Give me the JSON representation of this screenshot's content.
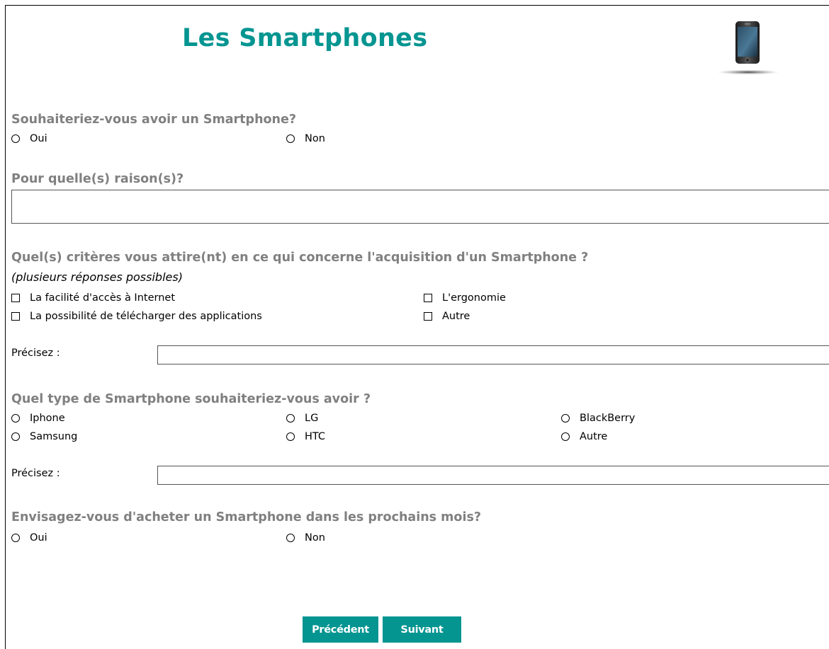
{
  "colors": {
    "accent": "#049591",
    "question": "#808080",
    "text": "#000000"
  },
  "page": {
    "title": "Les Smartphones",
    "logo_icon": "smartphone-icon"
  },
  "q1": {
    "question": "Souhaiteriez-vous avoir un Smartphone?",
    "options": [
      "Oui",
      "Non"
    ]
  },
  "q2": {
    "question": "Pour quelle(s) raison(s)?",
    "value": ""
  },
  "q3": {
    "question": "Quel(s) critères vous attire(nt) en ce qui concerne l'acquisition d'un Smartphone ?",
    "note": "(plusieurs réponses possibles)",
    "options": [
      "La facilité d'accès à Internet",
      "L'ergonomie",
      "La possibilité de télécharger des applications",
      "Autre"
    ],
    "precise_label": "Précisez :",
    "precise_value": ""
  },
  "q4": {
    "question": "Quel type de Smartphone souhaiteriez-vous avoir ?",
    "options": [
      "Iphone",
      "LG",
      "BlackBerry",
      "Samsung",
      "HTC",
      "Autre"
    ],
    "precise_label": "Précisez :",
    "precise_value": ""
  },
  "q5": {
    "question": "Envisagez-vous d'acheter un Smartphone dans les prochains mois?",
    "options": [
      "Oui",
      "Non"
    ]
  },
  "nav": {
    "previous_label": "Précédent",
    "next_label": "Suivant"
  }
}
